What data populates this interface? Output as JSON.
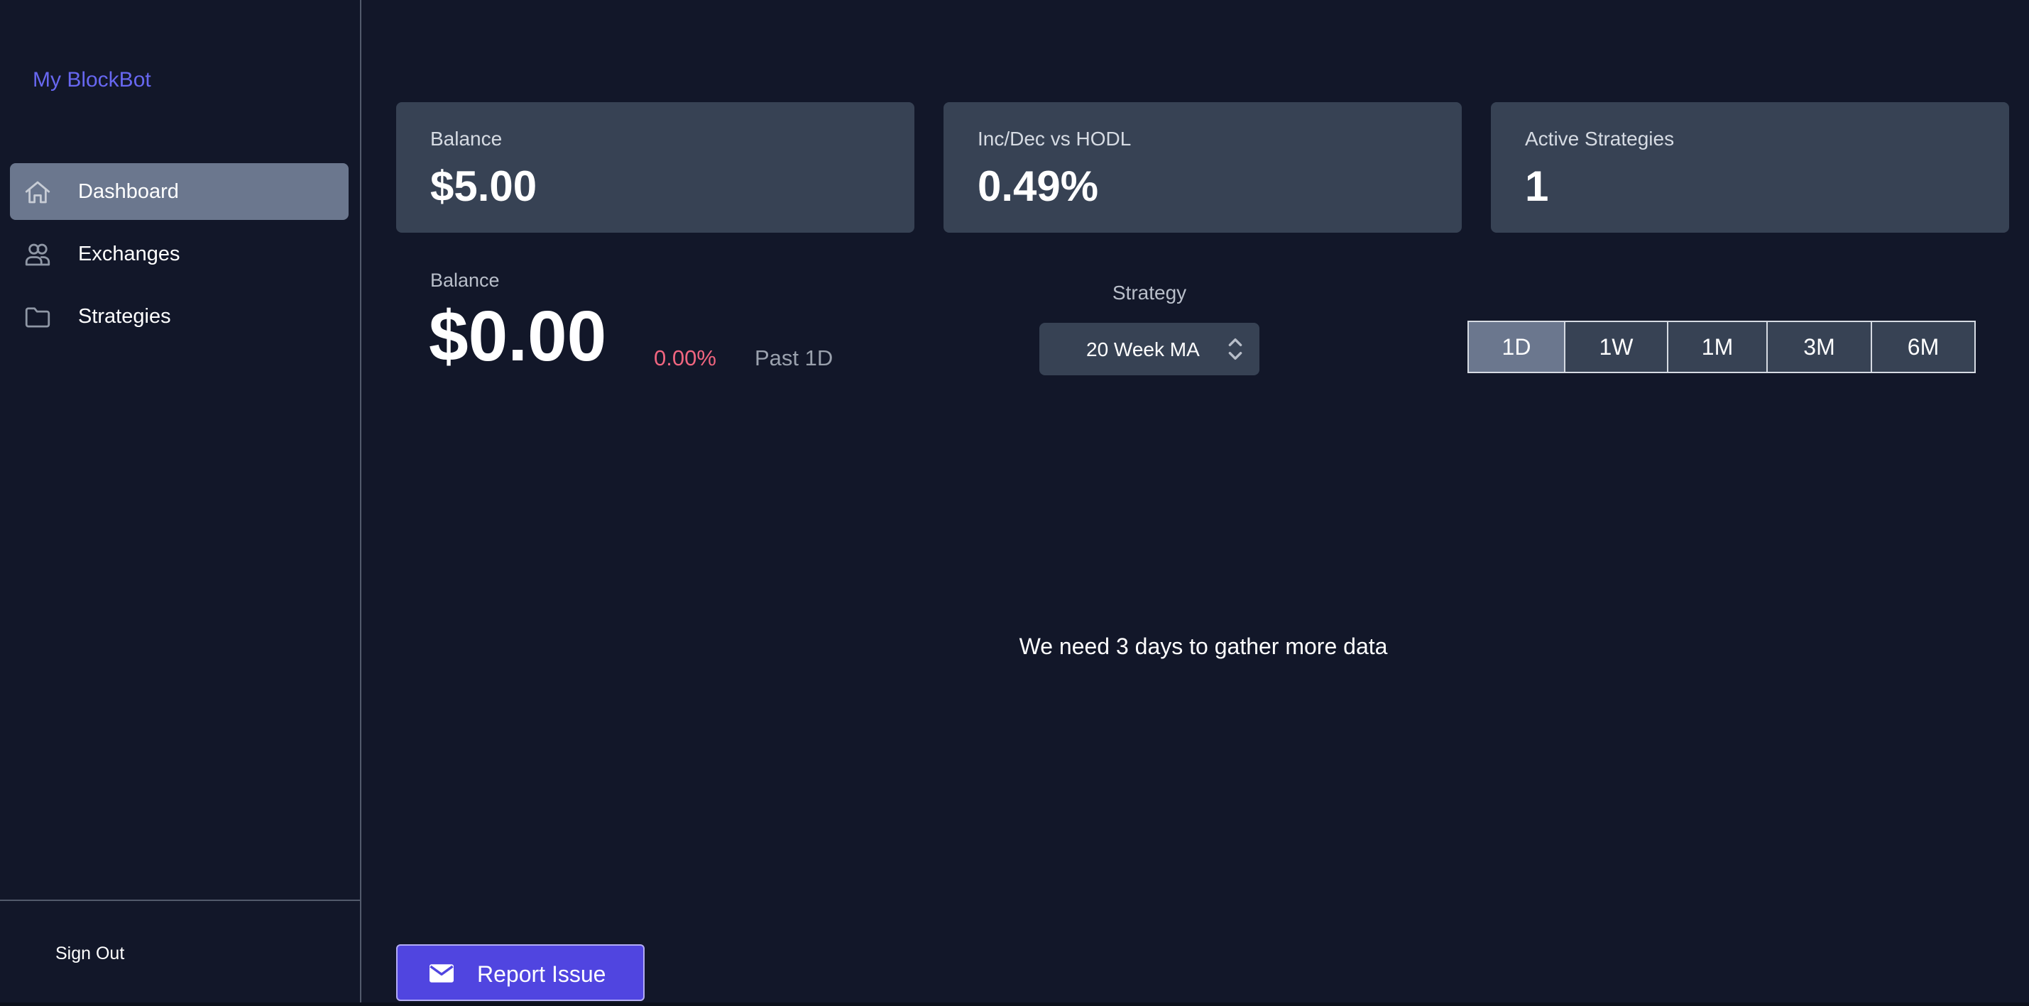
{
  "app": {
    "brand": "My BlockBot"
  },
  "sidebar": {
    "items": [
      {
        "label": "Dashboard",
        "icon": "home-icon",
        "active": true
      },
      {
        "label": "Exchanges",
        "icon": "users-icon",
        "active": false
      },
      {
        "label": "Strategies",
        "icon": "folder-icon",
        "active": false
      }
    ],
    "sign_out": "Sign Out"
  },
  "stats": [
    {
      "label": "Balance",
      "value": "$5.00"
    },
    {
      "label": "Inc/Dec vs HODL",
      "value": "0.49%"
    },
    {
      "label": "Active Strategies",
      "value": "1"
    }
  ],
  "balance": {
    "label": "Balance",
    "value": "$0.00",
    "change": "0.00%",
    "period": "Past 1D"
  },
  "strategy": {
    "label": "Strategy",
    "selected": "20 Week MA"
  },
  "ranges": {
    "options": [
      "1D",
      "1W",
      "1M",
      "3M",
      "6M"
    ],
    "selected": "1D"
  },
  "chart": {
    "empty_message": "We need 3 days to gather more data"
  },
  "report": {
    "label": "Report Issue",
    "icon": "mail-icon"
  },
  "colors": {
    "background": "#121729",
    "card": "#374254",
    "active": "#6b778e",
    "brand": "#6767f0",
    "negative": "#f0657f",
    "report_button": "#5045e0"
  }
}
